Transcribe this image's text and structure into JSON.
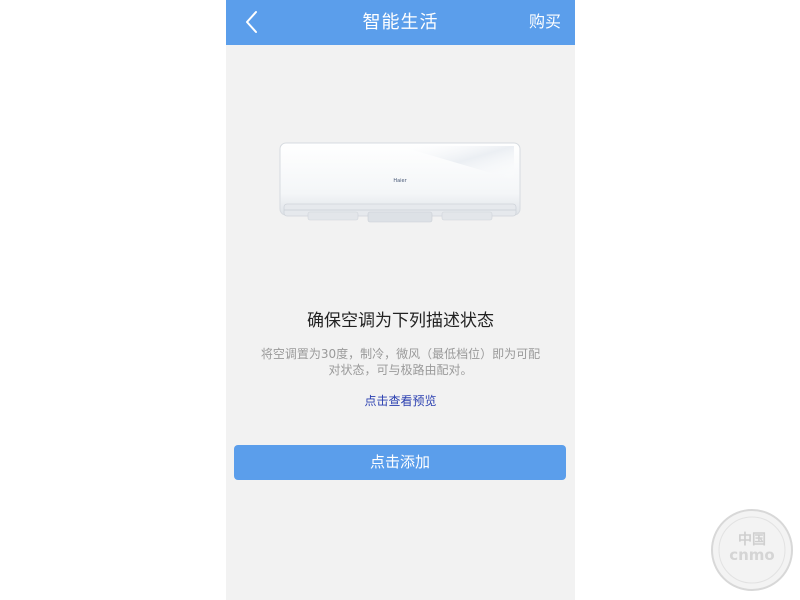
{
  "header": {
    "title": "智能生活",
    "buy_label": "购买",
    "back_icon": "chevron-left-icon",
    "bar_color": "#5b9eeb"
  },
  "device": {
    "brand_label": "Haier",
    "image": "air-conditioner-illustration"
  },
  "main": {
    "heading": "确保空调为下列描述状态",
    "description": "将空调置为30度，制冷，微风（最低档位）即为可配对状态，可与极路由配对。",
    "preview_link": "点击查看预览",
    "add_button": "点击添加"
  },
  "watermark": {
    "text_top": "中国",
    "text_mid": "cnmo",
    "icon": "cnmo-watermark-logo"
  }
}
